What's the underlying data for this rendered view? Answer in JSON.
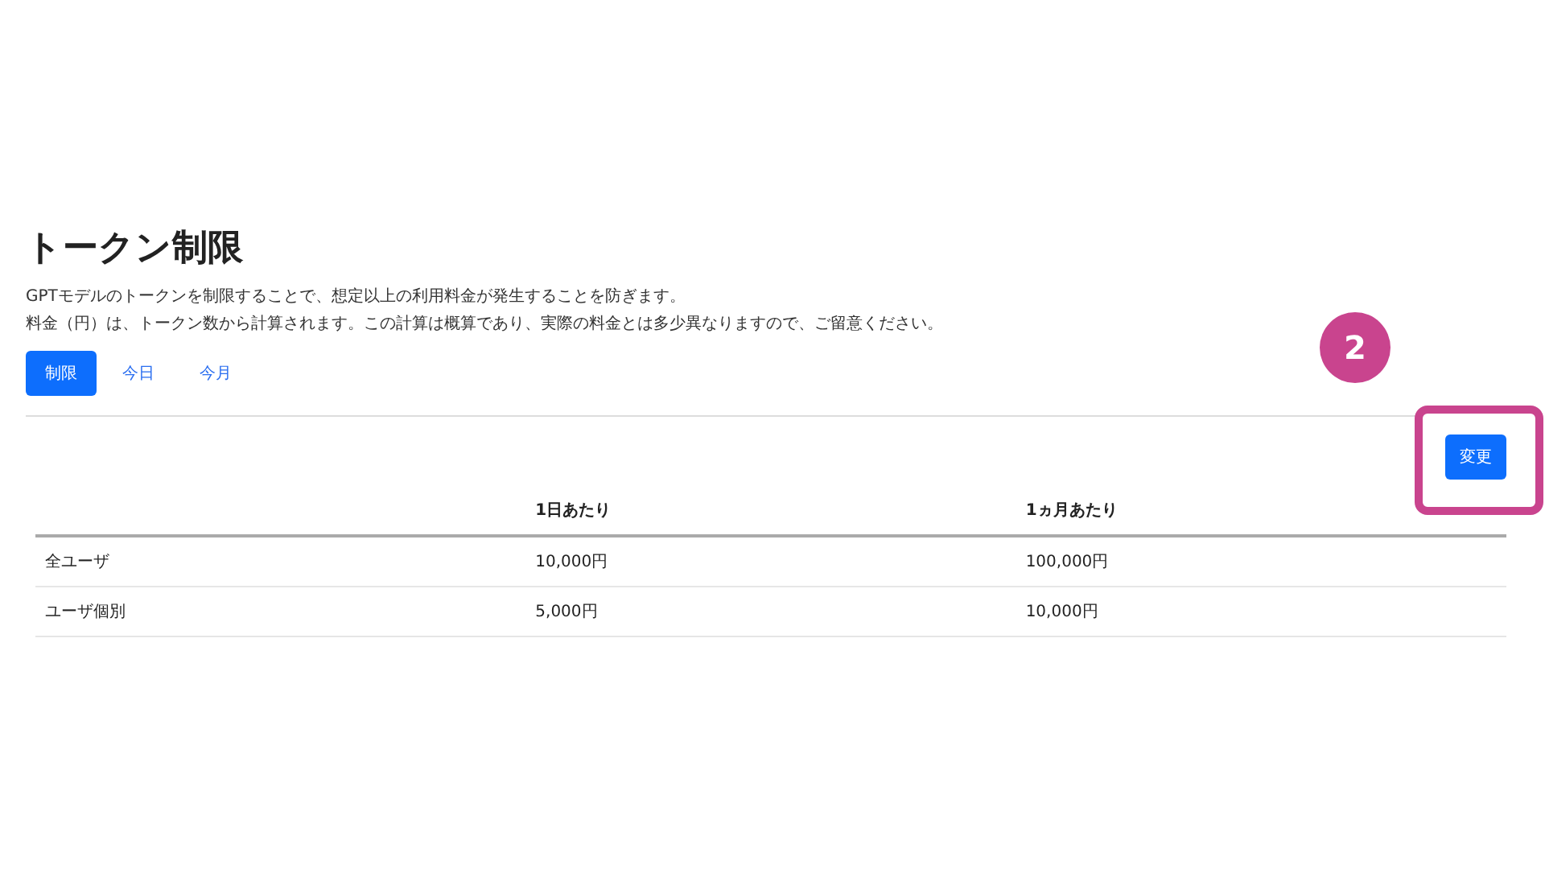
{
  "page": {
    "title": "トークン制限",
    "description": [
      "GPTモデルのトークンを制限することで、想定以上の利用料金が発生することを防ぎます。",
      "料金（円）は、トークン数から計算されます。この計算は概算であり、実際の料金とは多少異なりますので、ご留意ください。"
    ]
  },
  "tabs": [
    {
      "label": "制限",
      "selected": true
    },
    {
      "label": "今日",
      "selected": false
    },
    {
      "label": "今月",
      "selected": false
    }
  ],
  "change_button": {
    "label": "変更"
  },
  "annotation": {
    "step": "2"
  },
  "table": {
    "columns": [
      "",
      "1日あたり",
      "1ヵ月あたり"
    ],
    "rows": [
      [
        "全ユーザ",
        "10,000円",
        "100,000円"
      ],
      [
        "ユーザ個別",
        "5,000円",
        "10,000円"
      ]
    ]
  }
}
